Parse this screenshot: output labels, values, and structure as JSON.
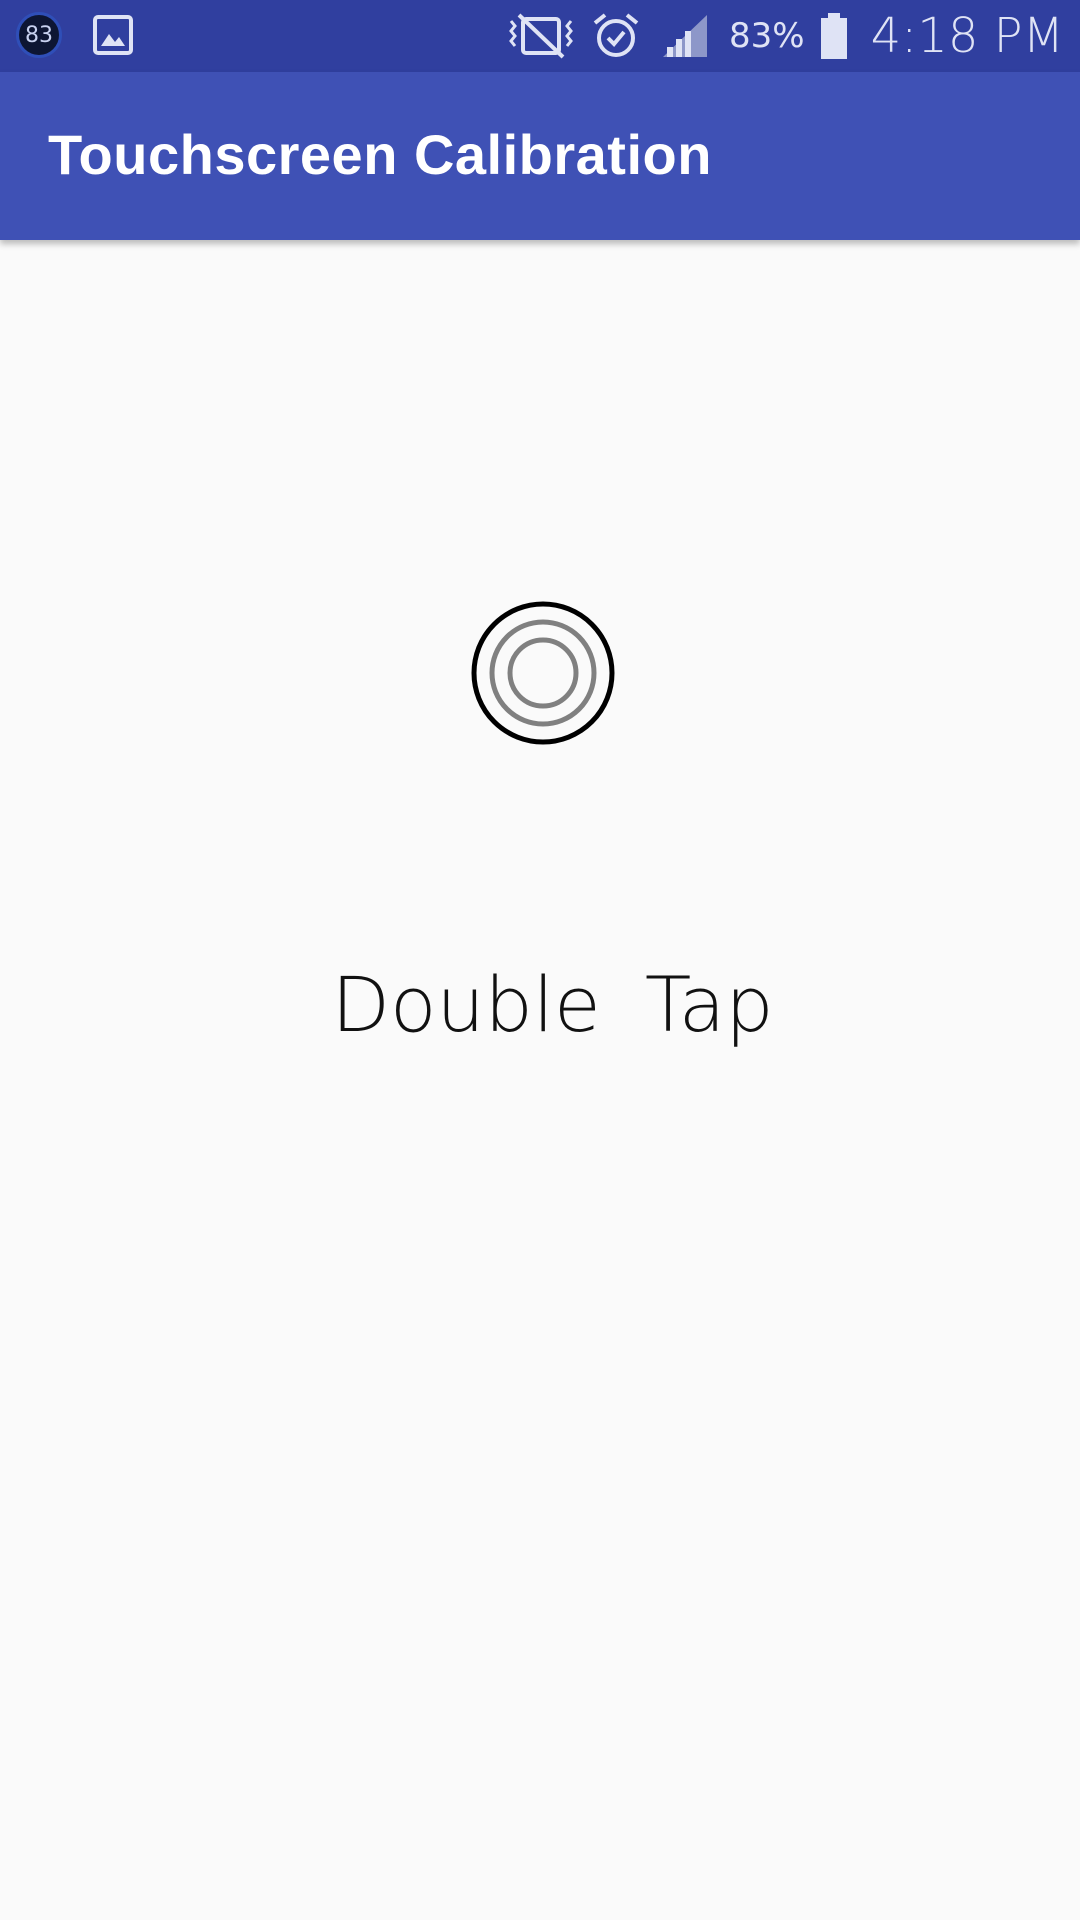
{
  "status_bar": {
    "notification_badge": "83",
    "battery_percent": "83%",
    "time": "4:18 PM",
    "icons": [
      "notification-83-icon",
      "gallery-icon",
      "vibrate-mute-icon",
      "alarm-icon",
      "signal-icon",
      "battery-icon"
    ]
  },
  "app_bar": {
    "title": "Touchscreen Calibration",
    "color": "#3f51b5",
    "status_color": "#303f9f"
  },
  "main": {
    "target_icon": "calibration-target-icon",
    "instruction": "Double  Tap"
  }
}
